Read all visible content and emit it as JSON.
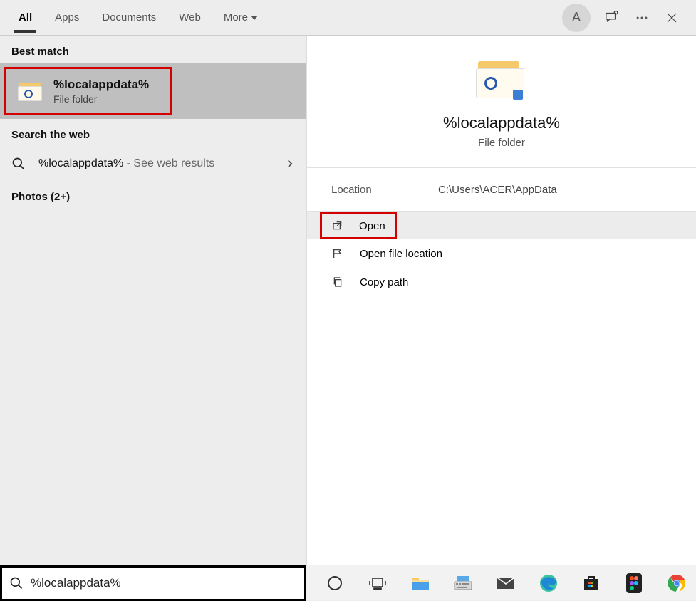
{
  "tabs": {
    "all": "All",
    "apps": "Apps",
    "documents": "Documents",
    "web": "Web",
    "more": "More"
  },
  "avatar_letter": "A",
  "left": {
    "best_match_header": "Best match",
    "best_match": {
      "title": "%localappdata%",
      "subtitle": "File folder"
    },
    "search_web_header": "Search the web",
    "web_result": {
      "query": "%localappdata%",
      "suffix": " - See web results"
    },
    "photos_header": "Photos (2+)"
  },
  "right": {
    "title": "%localappdata%",
    "subtitle": "File folder",
    "location_label": "Location",
    "location_value": "C:\\Users\\ACER\\AppData",
    "actions": {
      "open": "Open",
      "open_location": "Open file location",
      "copy_path": "Copy path"
    }
  },
  "search_value": "%localappdata%"
}
